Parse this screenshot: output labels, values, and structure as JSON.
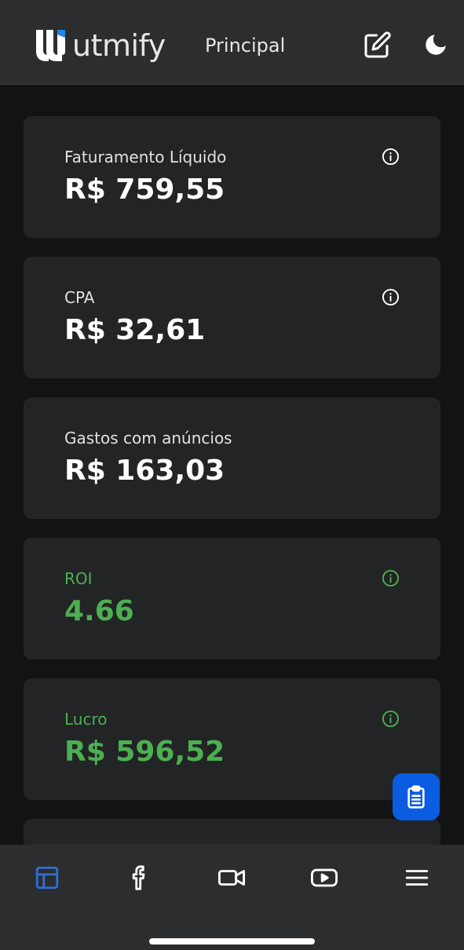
{
  "header": {
    "brand": "utmify",
    "title": "Principal",
    "edit_icon": "edit-icon",
    "theme_icon": "moon-icon"
  },
  "cards": [
    {
      "label": "Faturamento Líquido",
      "value": "R$ 759,55",
      "has_info": true,
      "tone": "neutral"
    },
    {
      "label": "CPA",
      "value": "R$ 32,61",
      "has_info": true,
      "tone": "neutral"
    },
    {
      "label": "Gastos com anúncios",
      "value": "R$ 163,03",
      "has_info": false,
      "tone": "neutral"
    },
    {
      "label": "ROI",
      "value": "4.66",
      "has_info": true,
      "tone": "positive"
    },
    {
      "label": "Lucro",
      "value": "R$ 596,52",
      "has_info": true,
      "tone": "positive"
    }
  ],
  "fab": {
    "icon": "clipboard-icon"
  },
  "bottom_nav": {
    "items": [
      {
        "icon": "dashboard-icon",
        "active": true
      },
      {
        "icon": "facebook-icon",
        "active": false
      },
      {
        "icon": "video-camera-icon",
        "active": false
      },
      {
        "icon": "youtube-icon",
        "active": false
      },
      {
        "icon": "menu-icon",
        "active": false
      }
    ]
  },
  "colors": {
    "background": "#121314",
    "header": "#2c2d2e",
    "card": "#222425",
    "positive": "#4caf50",
    "accent": "#0a5ce0",
    "nav_active": "#2f6fd6"
  }
}
